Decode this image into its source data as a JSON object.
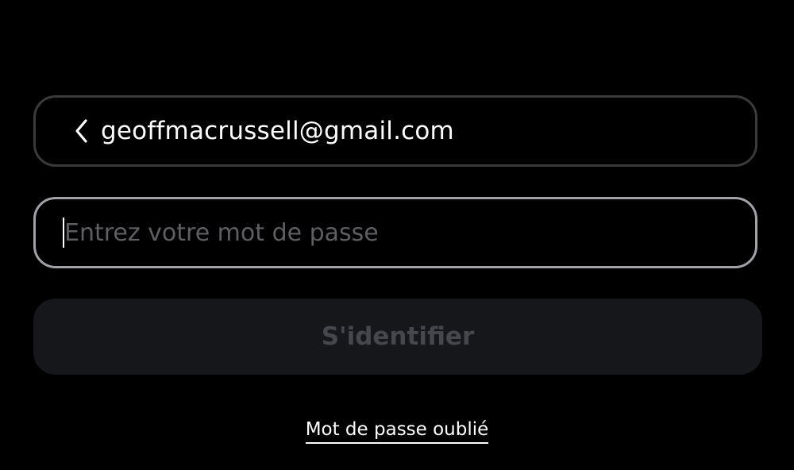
{
  "login": {
    "email": "geoffmacrussell@gmail.com",
    "back_icon": "chevron-left-icon",
    "password_placeholder": "Entrez votre mot de passe",
    "password_value": "",
    "submit_label": "S'identifier",
    "forgot_label": "Mot de passe oublié"
  },
  "colors": {
    "background": "#000000",
    "email_border": "#3a3a3c",
    "password_border_focused": "#a1a1a8",
    "placeholder": "#5e5e63",
    "button_disabled_bg": "#16171a",
    "button_disabled_text": "#46474c",
    "text": "#ffffff"
  }
}
